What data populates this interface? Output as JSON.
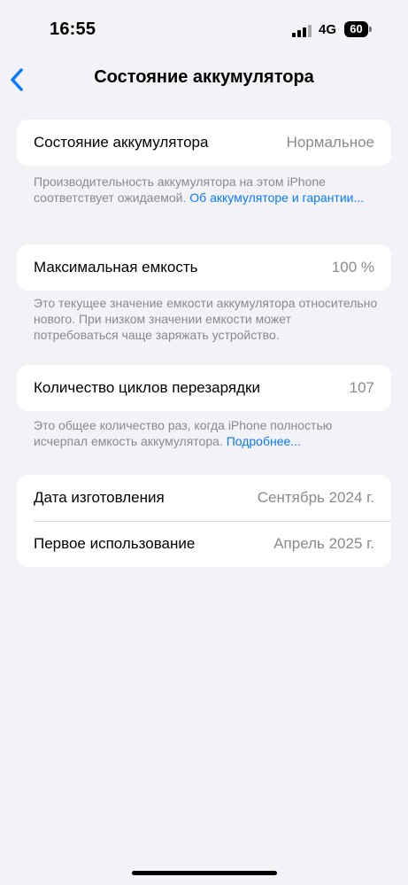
{
  "status_bar": {
    "time": "16:55",
    "network": "4G",
    "battery": "60",
    "icons": [
      "signal-icon",
      "battery-icon"
    ]
  },
  "nav": {
    "title": "Состояние аккумулятора",
    "back_icon": "chevron-left-icon"
  },
  "battery_health": {
    "label": "Состояние аккумулятора",
    "value": "Нормальное",
    "footnote": "Производительность аккумулятора на этом iPhone соответствует ожидаемой.",
    "footnote_link": "Об аккумуляторе и гарантии..."
  },
  "max_capacity": {
    "label": "Максимальная емкость",
    "value": "100 %",
    "footnote": "Это текущее значение емкости аккумулятора относительно нового. При низком значении емкости может потребоваться чаще заряжать устройство."
  },
  "cycle_count": {
    "label": "Количество циклов перезарядки",
    "value": "107",
    "footnote": "Это общее количество раз, когда iPhone полностью исчерпал емкость аккумулятора.",
    "footnote_link": "Подробнее..."
  },
  "dates": {
    "manufacture_label": "Дата изготовления",
    "manufacture_value": "Сентябрь 2024 г.",
    "first_use_label": "Первое использование",
    "first_use_value": "Апрель 2025 г."
  },
  "colors": {
    "background": "#f2f2f7",
    "card": "#ffffff",
    "accent": "#0a7aff",
    "secondary_text": "#8a8a8e"
  }
}
